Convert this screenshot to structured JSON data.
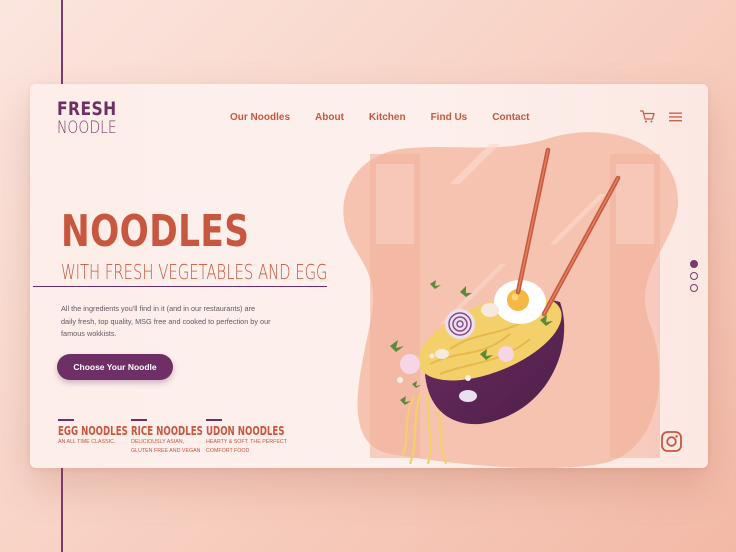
{
  "brand": {
    "line1": "FRESH",
    "line2": "NOODLE"
  },
  "nav": {
    "items": [
      {
        "label": "Our Noodles"
      },
      {
        "label": "About"
      },
      {
        "label": "Kitchen"
      },
      {
        "label": "Find Us"
      },
      {
        "label": "Contact"
      }
    ]
  },
  "header_icons": [
    "cart-icon",
    "menu-icon"
  ],
  "hero": {
    "title": "NOODLES",
    "subtitle": "WITH FRESH VEGETABLES AND EGG",
    "description": "All the ingredients you'll find in it (and in our restaurants) are daily fresh, top quality, MSG free and cooked to perfection by our famous wokkists.",
    "cta_label": "Choose Your Noodle"
  },
  "categories": [
    {
      "name": "EGG NOODLES",
      "line1": "AN ALL TIME CLASSIC.",
      "line2": ""
    },
    {
      "name": "RICE NOODLES",
      "line1": "DELICIOUSLY ASIAN,",
      "line2": "GLUTEN FREE AND VEGAN"
    },
    {
      "name": "UDON NOODLES",
      "line1": "HEARTY & SOFT. THE PERFECT",
      "line2": "COMFORT FOOD"
    }
  ],
  "slider": {
    "count": 3,
    "active": 1
  },
  "social_icon": "instagram-icon",
  "colors": {
    "accent": "#c8573f",
    "brand_purple": "#6e2f66",
    "card_bg": "#fdeeea",
    "blob": "#f6c3b0",
    "noodle_yellow": "#f3d06a"
  }
}
